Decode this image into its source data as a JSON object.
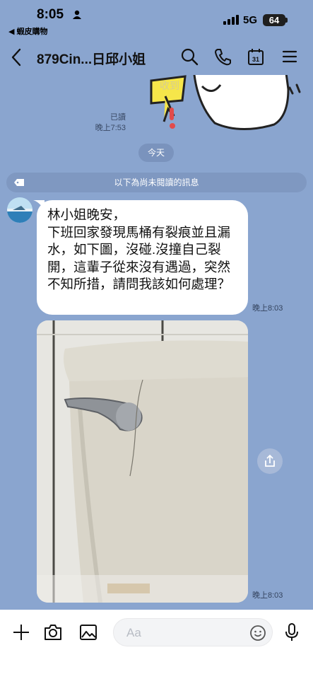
{
  "status": {
    "time": "8:05",
    "back_app": "◀ 蝦皮購物",
    "network": "5G",
    "battery": "64"
  },
  "header": {
    "title": "879Cin...日邱小姐",
    "icons": [
      "back-arrow-icon",
      "search-icon",
      "phone-icon",
      "calendar-icon",
      "menu-icon"
    ],
    "calendar_day": "31"
  },
  "sticker_caption": "收到",
  "previous": {
    "read_label": "已讀",
    "time": "晚上7:53"
  },
  "date_separator": "今天",
  "unread_divider": "以下為尚未閱讀的訊息",
  "message": {
    "text": "林小姐晚安，\n下班回家發現馬桶有裂痕並且漏水，如下圖，沒碰.沒撞自己裂開，這輩子從來沒有遇過，突然不知所措，請問我該如何處理？",
    "time": "晚上8:03"
  },
  "photo_message": {
    "time": "晚上8:03"
  },
  "input_bar": {
    "placeholder": "Aa",
    "icons": [
      "plus-icon",
      "camera-icon",
      "image-icon",
      "emoji-icon",
      "microphone-icon"
    ]
  },
  "colors": {
    "chat_background": "#8aa5cf",
    "bubble": "#ffffff",
    "pill": "#7a93bd"
  }
}
